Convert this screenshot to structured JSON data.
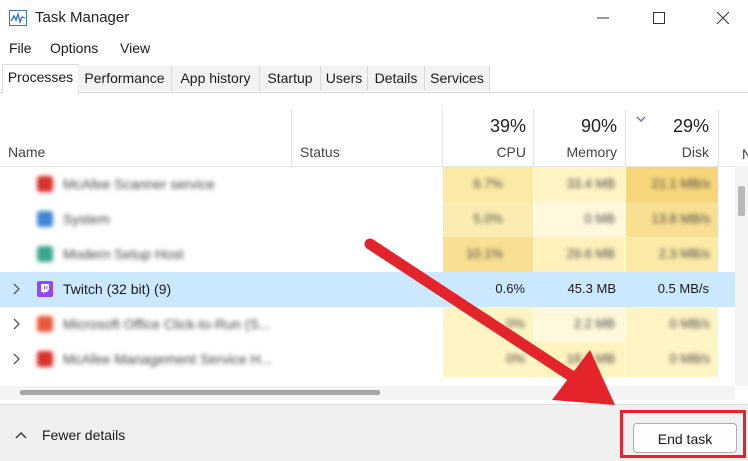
{
  "window": {
    "title": "Task Manager"
  },
  "menu": [
    "File",
    "Options",
    "View"
  ],
  "tabs": [
    "Processes",
    "Performance",
    "App history",
    "Startup",
    "Users",
    "Details",
    "Services"
  ],
  "columns": {
    "name": "Name",
    "status": "Status",
    "cpu": {
      "label": "CPU",
      "percent": "39%"
    },
    "memory": {
      "label": "Memory",
      "percent": "90%"
    },
    "disk": {
      "label": "Disk",
      "percent": "29%"
    },
    "network_partial": "N"
  },
  "rows": [
    {
      "name": "McAfee Scanner service",
      "cpu": "6.7%",
      "memory": "33.4 MB",
      "disk": "21.1 MB/s",
      "icon": "mcafee-icon",
      "blurred": true
    },
    {
      "name": "System",
      "cpu": "5.0%",
      "memory": "0 MB",
      "disk": "13.8 MB/s",
      "icon": "system-icon",
      "blurred": true
    },
    {
      "name": "Modern Setup Host",
      "cpu": "10.1%",
      "memory": "29.6 MB",
      "disk": "2.3 MB/s",
      "icon": "setup-host-icon",
      "blurred": true
    },
    {
      "name": "Twitch (32 bit) (9)",
      "cpu": "0.6%",
      "memory": "45.3 MB",
      "disk": "0.5 MB/s",
      "icon": "twitch-icon",
      "blurred": false,
      "selected": true
    },
    {
      "name": "Microsoft Office Click-to-Run (S...",
      "cpu": "0%",
      "memory": "2.2 MB",
      "disk": "0 MB/s",
      "icon": "office-icon",
      "blurred": true
    },
    {
      "name": "McAfee Management Service H...",
      "cpu": "0%",
      "memory": "18.3 MB",
      "disk": "0 MB/s",
      "icon": "mcafee-icon",
      "blurred": true
    }
  ],
  "footer": {
    "fewer_details": "Fewer details",
    "end_task": "End task"
  },
  "colors": {
    "accent_red": "#e3242b",
    "selection": "#cce8ff",
    "heat": "#fff4c4"
  }
}
